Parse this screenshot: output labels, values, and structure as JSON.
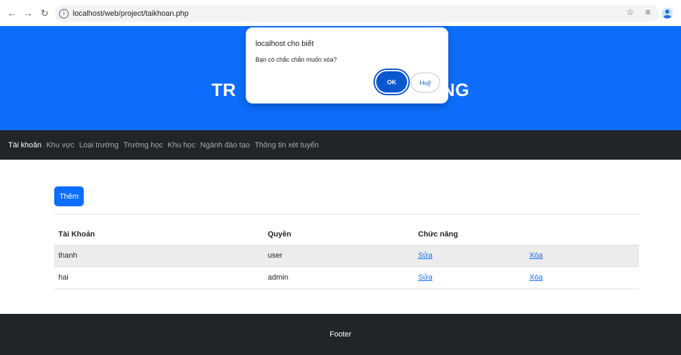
{
  "browser": {
    "url": "localhost/web/project/taikhoan.php"
  },
  "hero": {
    "title_left": "TR",
    "title_right": "NG"
  },
  "nav": {
    "items": [
      "Tài khoản",
      "Khu vực",
      "Loại trường",
      "Trường học",
      "Khu học",
      "Ngành đào tạo",
      "Thông tin xét tuyển"
    ]
  },
  "main": {
    "add_button": "Thêm",
    "table": {
      "headers": [
        "Tài Khoản",
        "Quyền",
        "Chức năng",
        ""
      ],
      "rows": [
        {
          "account": "thanh",
          "role": "user",
          "edit": "Sửa",
          "delete": "Xóa"
        },
        {
          "account": "hai",
          "role": "admin",
          "edit": "Sửa",
          "delete": "Xóa"
        }
      ]
    }
  },
  "footer": {
    "text": "Footer"
  },
  "dialog": {
    "title": "localhost cho biết",
    "message": "Bạn có chắc chắn muốn xóa?",
    "ok_label": "OK",
    "cancel_label": "Huỷ"
  },
  "colors": {
    "primary": "#0d6efd",
    "dark": "#212529",
    "dialog_button": "#0b57d0"
  }
}
